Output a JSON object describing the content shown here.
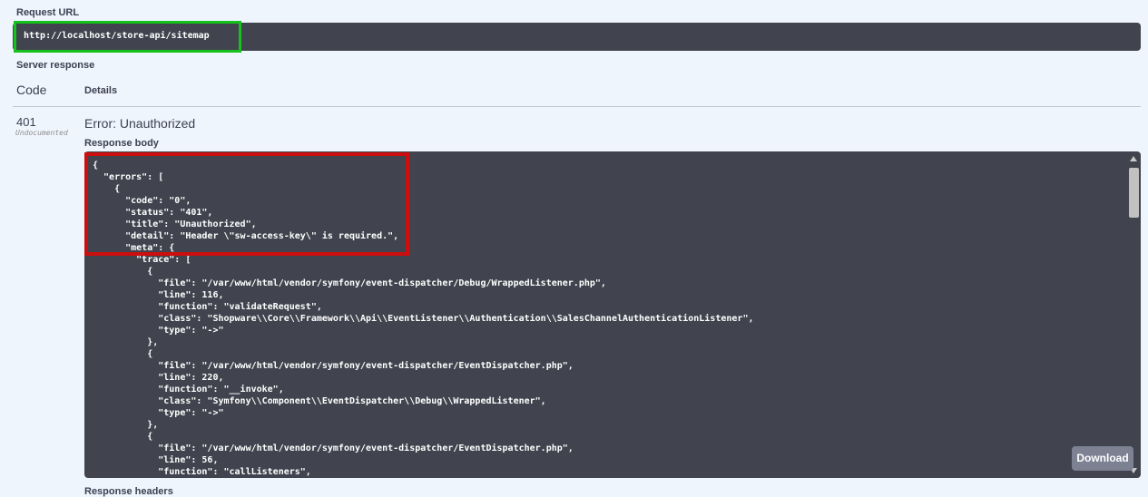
{
  "request_url": {
    "label": "Request URL",
    "value": "http://localhost/store-api/sitemap"
  },
  "server_response": {
    "label": "Server response",
    "code_header": "Code",
    "details_header": "Details",
    "code": "401",
    "code_note": "Undocumented",
    "error_title": "Error: Unauthorized",
    "response_body_label": "Response body",
    "response_body": "{\n  \"errors\": [\n    {\n      \"code\": \"0\",\n      \"status\": \"401\",\n      \"title\": \"Unauthorized\",\n      \"detail\": \"Header \\\"sw-access-key\\\" is required.\",\n      \"meta\": {\n        \"trace\": [\n          {\n            \"file\": \"/var/www/html/vendor/symfony/event-dispatcher/Debug/WrappedListener.php\",\n            \"line\": 116,\n            \"function\": \"validateRequest\",\n            \"class\": \"Shopware\\\\Core\\\\Framework\\\\Api\\\\EventListener\\\\Authentication\\\\SalesChannelAuthenticationListener\",\n            \"type\": \"->\"\n          },\n          {\n            \"file\": \"/var/www/html/vendor/symfony/event-dispatcher/EventDispatcher.php\",\n            \"line\": 220,\n            \"function\": \"__invoke\",\n            \"class\": \"Symfony\\\\Component\\\\EventDispatcher\\\\Debug\\\\WrappedListener\",\n            \"type\": \"->\"\n          },\n          {\n            \"file\": \"/var/www/html/vendor/symfony/event-dispatcher/EventDispatcher.php\",\n            \"line\": 56,\n            \"function\": \"callListeners\",",
    "download_label": "Download",
    "response_headers_label": "Response headers"
  },
  "colors": {
    "page_bg": "#eff5fd",
    "code_bg": "#41444e",
    "highlight_green": "#14c21b",
    "highlight_red": "#cc0e0e",
    "download_bg": "#7d8293"
  }
}
